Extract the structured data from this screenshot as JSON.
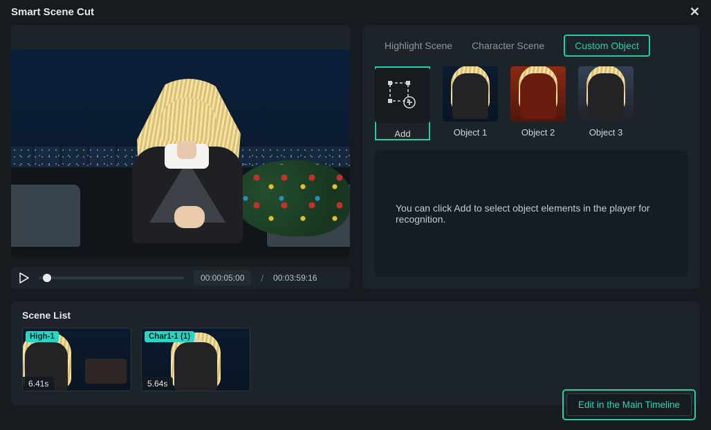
{
  "header": {
    "title": "Smart Scene Cut"
  },
  "player": {
    "current_time": "00:00:05:00",
    "separator": "/",
    "total_time": "00:03:59:16"
  },
  "tabs": {
    "highlight": "Highlight Scene",
    "character": "Character Scene",
    "custom": "Custom Object",
    "active": "custom"
  },
  "objects": {
    "add_label": "Add",
    "items": [
      {
        "label": "Object 1"
      },
      {
        "label": "Object 2"
      },
      {
        "label": "Object 3"
      }
    ]
  },
  "hint": "You can click Add to select object elements in the player for recognition.",
  "scene_list": {
    "title": "Scene List",
    "scenes": [
      {
        "badge": "High-1",
        "duration": "6.41s"
      },
      {
        "badge": "Char1-1 (1)",
        "duration": "5.64s"
      }
    ]
  },
  "actions": {
    "edit_timeline": "Edit in the Main Timeline"
  },
  "colors": {
    "accent": "#23cfa6"
  }
}
